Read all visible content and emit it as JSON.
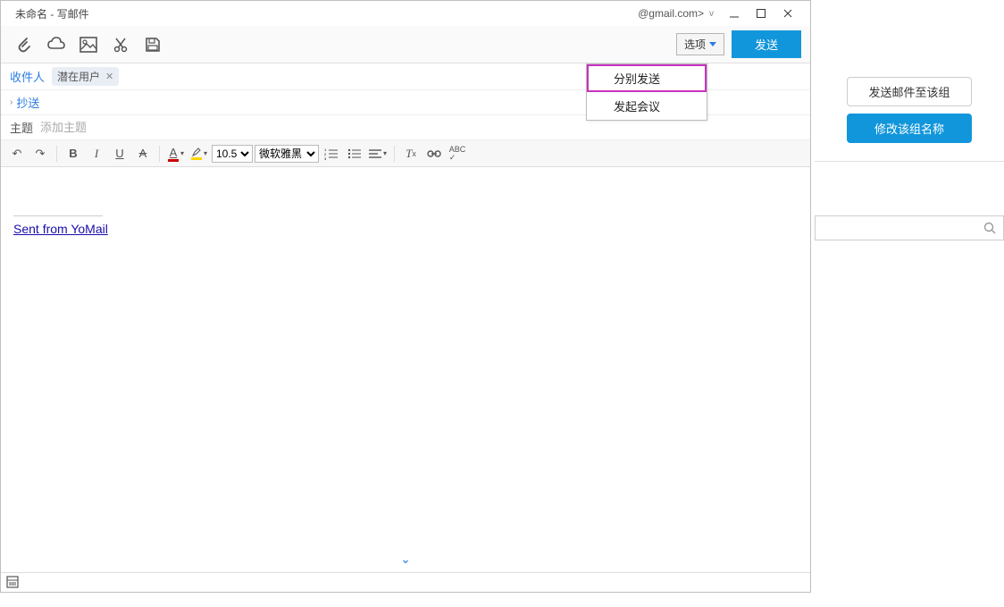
{
  "titlebar": {
    "title": "未命名  -  写邮件",
    "account": "@gmail.com>"
  },
  "action": {
    "options_label": "选项",
    "send_label": "发送"
  },
  "options_menu": {
    "items": [
      "分别发送",
      "发起会议"
    ]
  },
  "recipient": {
    "label": "收件人",
    "chip": "潜在用户"
  },
  "cc": {
    "label": "抄送"
  },
  "subject": {
    "label": "主题",
    "placeholder": "添加主题"
  },
  "editor": {
    "font_size": "10.5",
    "font_family": "微软雅黑"
  },
  "body": {
    "signature": "Sent from YoMail"
  },
  "side": {
    "btn_send": "发送邮件至该组",
    "btn_rename": "修改该组名称"
  }
}
